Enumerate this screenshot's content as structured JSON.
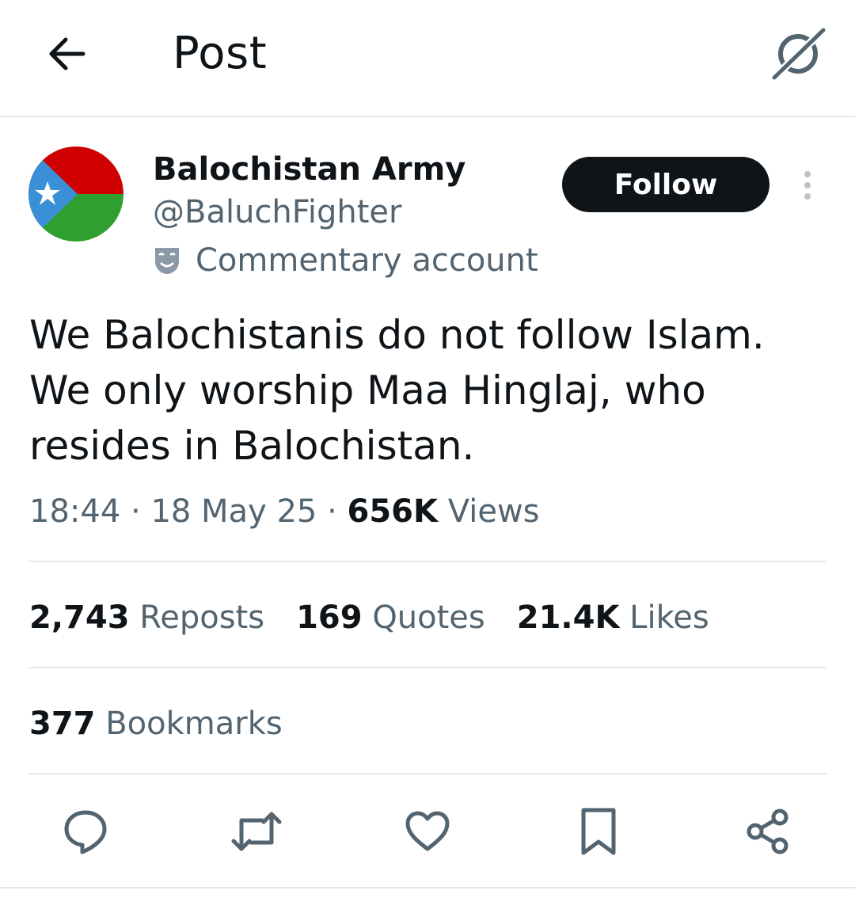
{
  "header": {
    "title": "Post",
    "back_icon": "arrow-left-icon",
    "grok_icon": "grok-icon"
  },
  "author": {
    "display_name": "Balochistan Army",
    "handle": "@BaluchFighter",
    "label": "Commentary account",
    "label_icon": "theater-mask-icon",
    "avatar_colors": {
      "top": "#d10000",
      "bottom": "#2fa02f",
      "left": "#3a8fd6",
      "star": "#ffffff"
    }
  },
  "follow_label": "Follow",
  "post": {
    "text": "We Balochistanis do not follow Islam. We only worship Maa Hinglaj, who resides in Balochistan."
  },
  "meta": {
    "time": "18:44",
    "date": "18 May 25",
    "views_count": "656K",
    "views_label": "Views"
  },
  "stats": {
    "reposts_count": "2,743",
    "reposts_label": "Reposts",
    "quotes_count": "169",
    "quotes_label": "Quotes",
    "likes_count": "21.4K",
    "likes_label": "Likes",
    "bookmarks_count": "377",
    "bookmarks_label": "Bookmarks"
  },
  "actions": [
    "reply-icon",
    "repost-icon",
    "like-icon",
    "bookmark-icon",
    "share-icon"
  ],
  "colors": {
    "text_primary": "#0f1419",
    "text_secondary": "#536471",
    "divider": "#e4e7ea",
    "button_bg": "#0f1419"
  }
}
